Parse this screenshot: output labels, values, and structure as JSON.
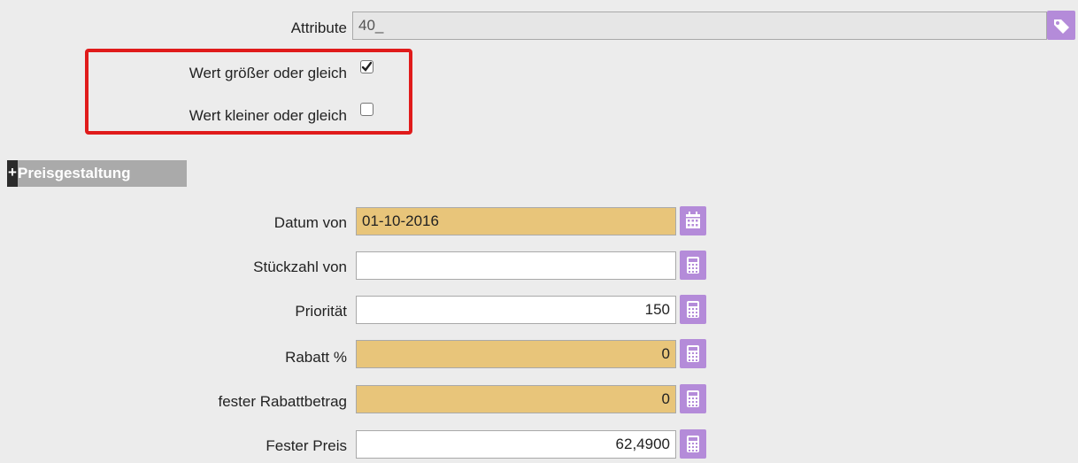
{
  "attribute": {
    "label": "Attribute",
    "value": "40_"
  },
  "options": {
    "ge_label": "Wert größer oder gleich",
    "ge_checked": true,
    "le_label": "Wert kleiner oder gleich",
    "le_checked": false
  },
  "section": {
    "toggle": "+",
    "title": "Preisgestaltung"
  },
  "fields": {
    "datum_von": {
      "label": "Datum von",
      "value": "01-10-2016"
    },
    "stueckzahl_von": {
      "label": "Stückzahl von",
      "value": ""
    },
    "prioritaet": {
      "label": "Priorität",
      "value": "150"
    },
    "rabatt": {
      "label": "Rabatt %",
      "value": "0"
    },
    "fester_rabattbetrag": {
      "label": "fester Rabattbetrag",
      "value": "0"
    },
    "fester_preis": {
      "label": "Fester Preis",
      "value": "62,4900"
    }
  },
  "icons": {
    "attribute_button": "tag-icon",
    "datum_button": "calendar-icon",
    "number_buttons": "calculator-icon"
  },
  "colors": {
    "background": "#ececec",
    "required_field": "#e8c57a",
    "icon_button": "#b48bd9",
    "highlight_border": "#e01b1b",
    "section_header": "#aaaaaa"
  }
}
